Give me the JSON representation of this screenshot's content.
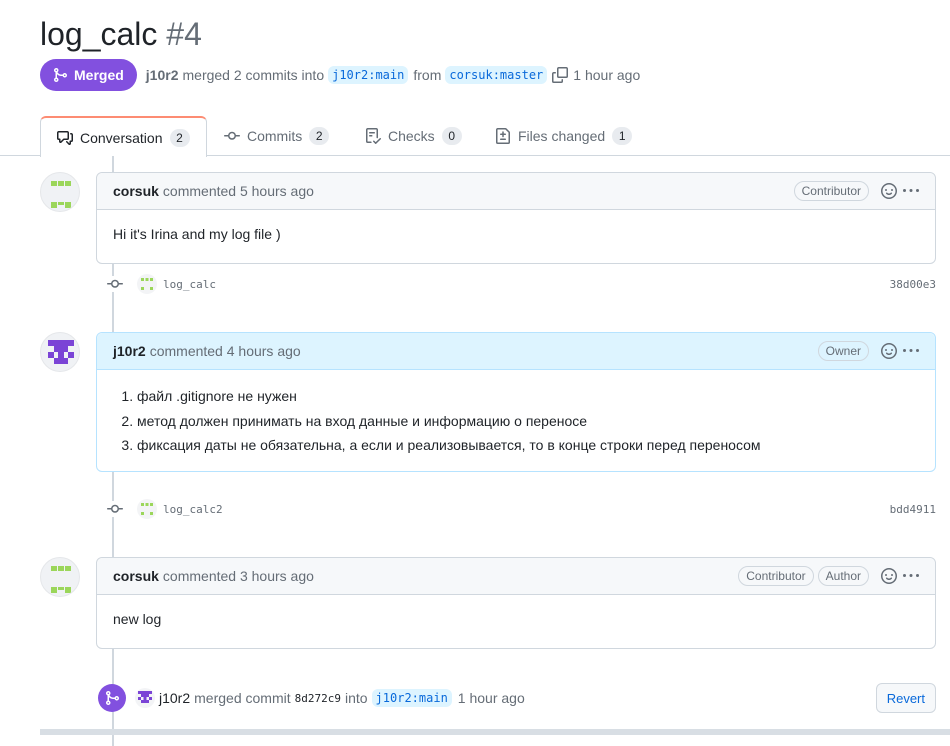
{
  "pr": {
    "title": "log_calc",
    "number": "#4",
    "state": "Merged",
    "author": "j10r2",
    "merged_text": "merged 2 commits into",
    "base_branch": "j10r2:main",
    "from_text": "from",
    "head_branch": "corsuk:master",
    "time": "1 hour ago"
  },
  "tabs": [
    {
      "label": "Conversation",
      "count": "2",
      "icon": "comment-discussion-icon"
    },
    {
      "label": "Commits",
      "count": "2",
      "icon": "git-commit-icon"
    },
    {
      "label": "Checks",
      "count": "0",
      "icon": "checklist-icon"
    },
    {
      "label": "Files changed",
      "count": "1",
      "icon": "file-diff-icon"
    }
  ],
  "comments": [
    {
      "author": "corsuk",
      "when": "commented 5 hours ago",
      "roles": [
        "Contributor"
      ],
      "body": "Hi it's Irina and my log file )"
    },
    {
      "author": "j10r2",
      "when": "commented 4 hours ago",
      "roles": [
        "Owner"
      ],
      "items": [
        "файл .gitignore не нужен",
        "метод должен принимать на вход данные и информацию о переносе",
        "фиксация даты не обязательна, а если и реализовывается, то в конце строки перед переносом"
      ]
    },
    {
      "author": "corsuk",
      "when": "commented 3 hours ago",
      "roles": [
        "Contributor",
        "Author"
      ],
      "body": "new log"
    }
  ],
  "commits": [
    {
      "message": "log_calc",
      "sha": "38d00e3"
    },
    {
      "message": "log_calc2",
      "sha": "bdd4911"
    }
  ],
  "merge_event": {
    "author": "j10r2",
    "text1": "merged commit",
    "sha": "8d272c9",
    "text2": "into",
    "branch": "j10r2:main",
    "time": "1 hour ago",
    "revert_label": "Revert"
  },
  "colors": {
    "merged_purple": "#8250df",
    "link_blue": "#0969da",
    "branch_bg": "#ddf4ff",
    "owner_header_bg": "#ddf4ff",
    "corsuk_avatar": "#9bd65a",
    "j10r2_avatar": "#7b44d6"
  }
}
